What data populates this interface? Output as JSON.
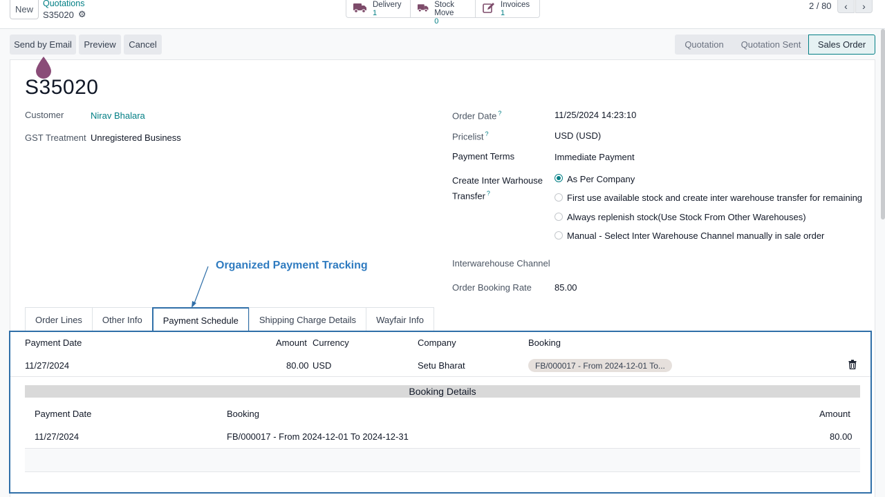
{
  "topbar": {
    "new_label": "New",
    "breadcrumb_parent": "Quotations",
    "breadcrumb_current": "S35020",
    "smart_buttons": [
      {
        "label": "Delivery",
        "count": "1",
        "icon": "truck-icon"
      },
      {
        "label": "Stock Move",
        "count": "0",
        "icon": "truck-icon"
      },
      {
        "label": "Invoices",
        "count": "1",
        "icon": "pencil-square-icon"
      }
    ],
    "pager": "2 / 80"
  },
  "actions": {
    "send_email": "Send by Email",
    "preview": "Preview",
    "cancel": "Cancel"
  },
  "statusbar": [
    "Quotation",
    "Quotation Sent",
    "Sales Order"
  ],
  "status_active": "Sales Order",
  "form": {
    "order_name": "S35020",
    "customer_label": "Customer",
    "customer_value": "Nirav Bhalara",
    "gst_label": "GST Treatment",
    "gst_value": "Unregistered Business",
    "order_date_label": "Order Date",
    "order_date_value": "11/25/2024 14:23:10",
    "pricelist_label": "Pricelist",
    "pricelist_value": "USD (USD)",
    "payment_terms_label": "Payment Terms",
    "payment_terms_value": "Immediate Payment",
    "iwt_label_1": "Create Inter Warhouse",
    "iwt_label_2": "Transfer",
    "help_mark": "?",
    "iwt_options": [
      "As Per Company",
      "First use available stock and create inter warehouse transfer for remaining",
      "Always replenish stock(Use Stock From Other Warehouses)",
      "Manual - Select Inter Warehouse Channel manually in sale order"
    ],
    "iwt_selected_index": 0,
    "channel_label": "Interwarehouse Channel",
    "booking_rate_label": "Order Booking Rate",
    "booking_rate_value": "85.00"
  },
  "annotation": "Organized Payment Tracking",
  "tabs": [
    "Order Lines",
    "Other Info",
    "Payment Schedule",
    "Shipping Charge Details",
    "Wayfair Info"
  ],
  "active_tab": "Payment Schedule",
  "schedule": {
    "headers": {
      "date": "Payment Date",
      "amount": "Amount",
      "currency": "Currency",
      "company": "Company",
      "booking": "Booking"
    },
    "row": {
      "date": "11/27/2024",
      "amount": "80.00",
      "currency": "USD",
      "company": "Setu Bharat",
      "booking": "FB/000017 - From 2024-12-01 To..."
    }
  },
  "booking_details": {
    "title": "Booking Details",
    "headers": {
      "date": "Payment Date",
      "booking": "Booking",
      "amount": "Amount"
    },
    "row": {
      "date": "11/27/2024",
      "booking": "FB/000017 - From 2024-12-01 To 2024-12-31",
      "amount": "80.00"
    }
  },
  "colors": {
    "accent": "#017e84",
    "highlight": "#2f6fa8",
    "annotation": "#2f7bc0"
  }
}
